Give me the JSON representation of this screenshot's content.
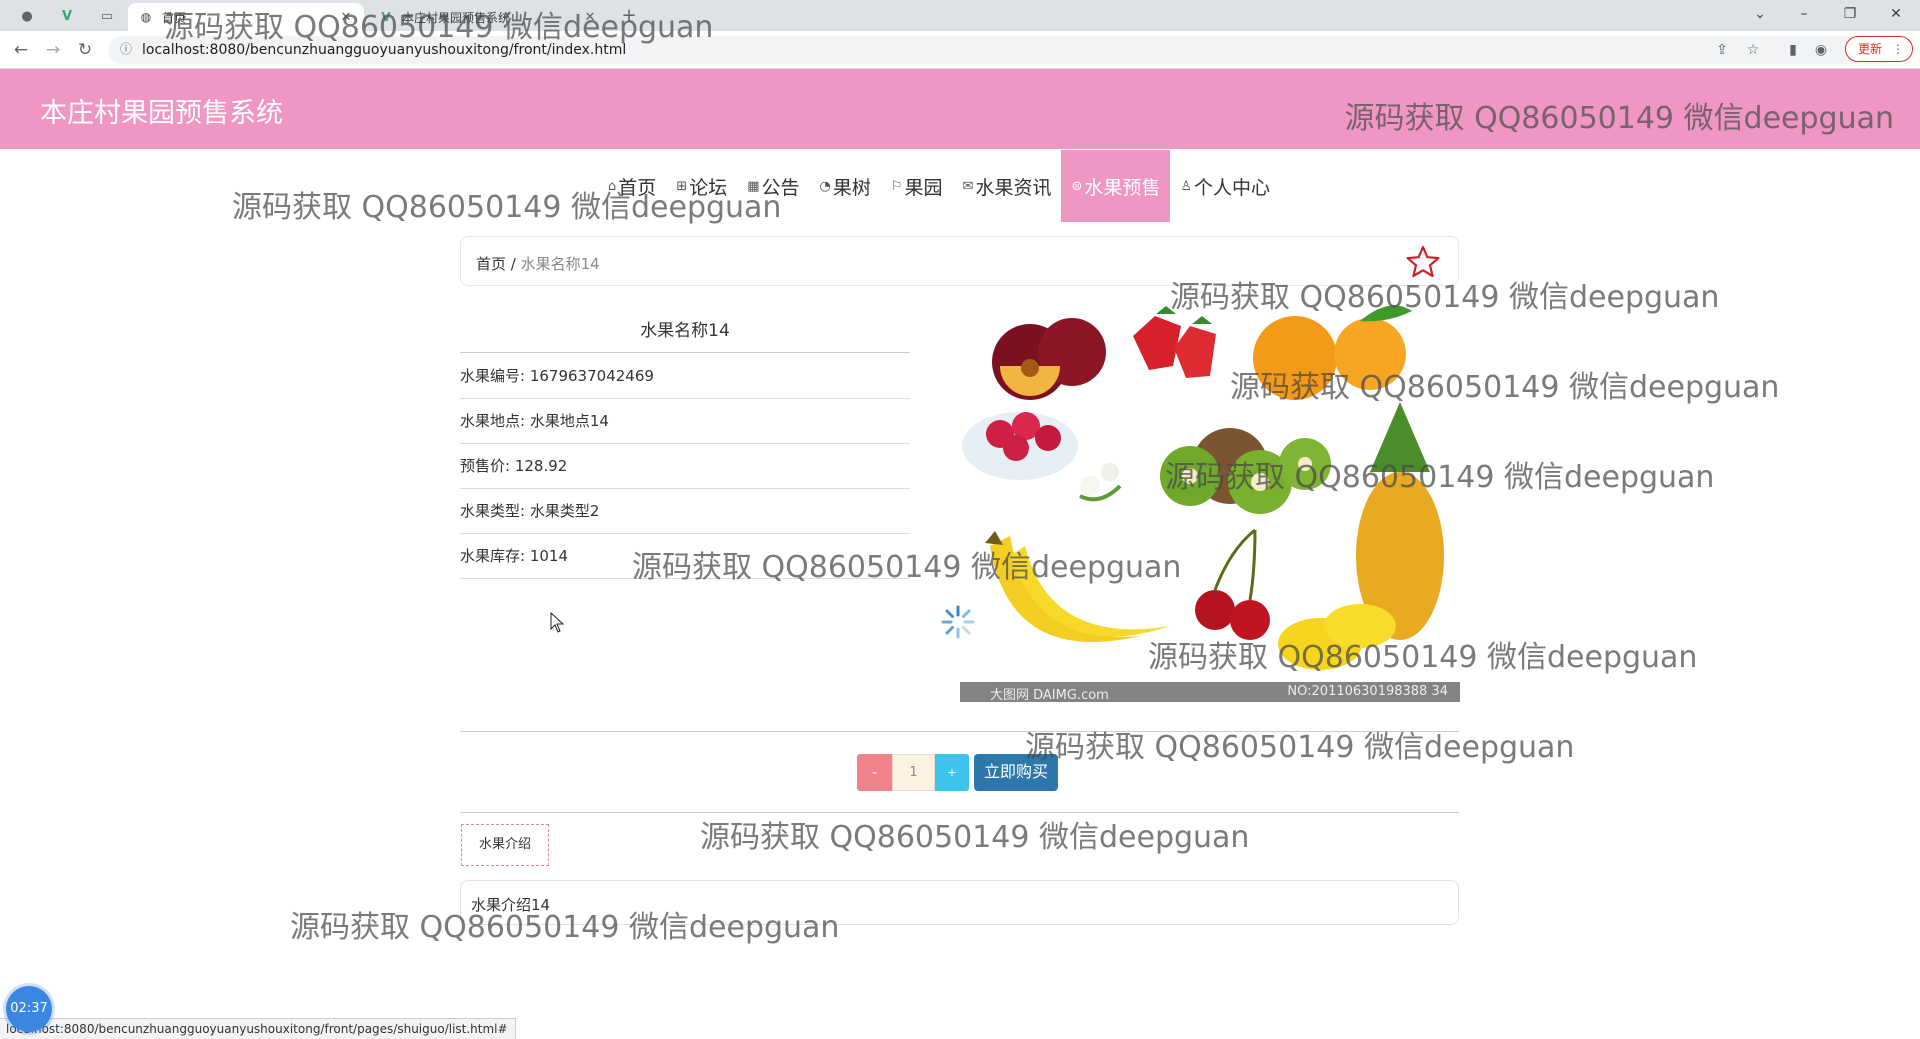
{
  "browser": {
    "tabs": [
      {
        "title": "首页",
        "active": true
      },
      {
        "title": "本庄村果园预售系统",
        "active": false
      }
    ],
    "url": "localhost:8080/bencunzhuangguoyuanyushouxitong/front/index.html",
    "update_label": "更新",
    "status_url": "localhost:8080/bencunzhuangguoyuanyushouxitong/front/pages/shuiguo/list.html#"
  },
  "site": {
    "title": "本庄村果园预售系统"
  },
  "nav": [
    {
      "label": "首页",
      "icon": "home-icon",
      "active": false
    },
    {
      "label": "论坛",
      "icon": "forum-icon",
      "active": false
    },
    {
      "label": "公告",
      "icon": "notice-icon",
      "active": false
    },
    {
      "label": "果树",
      "icon": "tree-icon",
      "active": false
    },
    {
      "label": "果园",
      "icon": "flag-icon",
      "active": false
    },
    {
      "label": "水果资讯",
      "icon": "mail-icon",
      "active": false
    },
    {
      "label": "水果预售",
      "icon": "presale-icon",
      "active": true
    },
    {
      "label": "个人中心",
      "icon": "user-icon",
      "active": false
    }
  ],
  "breadcrumb": {
    "home": "首页",
    "sep": "/",
    "current": "水果名称14"
  },
  "product": {
    "name": "水果名称14",
    "fields": [
      {
        "label": "水果编号",
        "value": "1679637042469"
      },
      {
        "label": "水果地点",
        "value": "水果地点14"
      },
      {
        "label": "预售价",
        "value": "128.92"
      },
      {
        "label": "水果类型",
        "value": "水果类型2"
      },
      {
        "label": "水果库存",
        "value": "1014"
      }
    ],
    "image_caption_left": "大图网 DAIMG.com",
    "image_caption_right": "NO:20110630198388 34"
  },
  "purchase": {
    "minus": "-",
    "quantity": "1",
    "plus": "+",
    "buy_label": "立即购买"
  },
  "intro": {
    "tab_label": "水果介绍",
    "content": "水果介绍14"
  },
  "watermark": "源码获取 QQ86050149 微信deepguan",
  "clock": "02:37",
  "colors": {
    "header_pink": "#f096c4",
    "buy_blue": "#2d78aa",
    "minus_red": "#f0828c",
    "plus_cyan": "#3ec3ec"
  }
}
